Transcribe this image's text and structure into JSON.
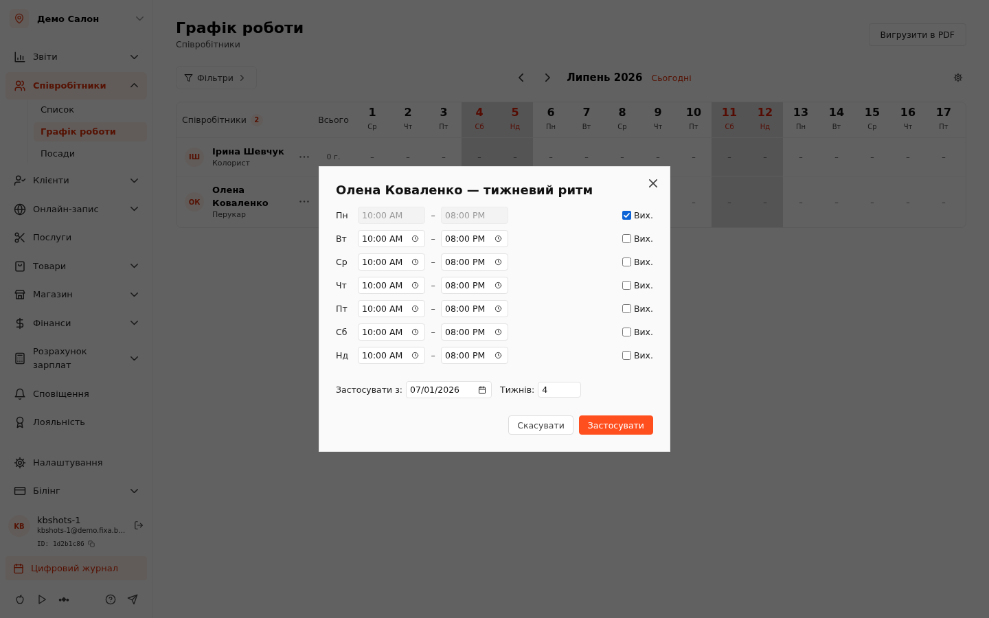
{
  "sidebar": {
    "brand": {
      "name": "Демо Салон"
    },
    "items": [
      {
        "label": "Звіти",
        "expanded": false,
        "selected": false
      },
      {
        "label": "Співробітники",
        "expanded": true,
        "selected": true,
        "children": [
          {
            "label": "Список",
            "selected": false
          },
          {
            "label": "Графік роботи",
            "selected": true
          },
          {
            "label": "Посади",
            "selected": false
          }
        ]
      },
      {
        "label": "Клієнти",
        "expanded": false,
        "selected": false
      },
      {
        "label": "Онлайн-запис",
        "expanded": false,
        "selected": false
      },
      {
        "label": "Послуги",
        "selected": false
      },
      {
        "label": "Товари",
        "expanded": false,
        "selected": false
      },
      {
        "label": "Магазин",
        "expanded": false,
        "selected": false
      },
      {
        "label": "Фінанси",
        "expanded": false,
        "selected": false
      },
      {
        "label": "Розрахунок зарплат",
        "expanded": false,
        "selected": false
      },
      {
        "label": "Сповіщення",
        "selected": false
      },
      {
        "label": "Лояльність",
        "selected": false
      }
    ],
    "footer_items": [
      {
        "label": "Налаштування",
        "selected": false
      },
      {
        "label": "Білінг",
        "expanded": false,
        "selected": false
      }
    ],
    "user": {
      "initials": "KB",
      "name": "kbshots-1",
      "email": "kbshots-1@demo.fixa.b…",
      "id": "ID: 1d2b1c86"
    },
    "journal_button": "Цифровий журнал"
  },
  "page": {
    "title": "Графік роботи",
    "subtitle": "Співробітники",
    "export_button": "Вигрузити в PDF"
  },
  "toolbar": {
    "filters_button": "Фільтри",
    "month": "Липень 2026",
    "today_link": "Сьогодні"
  },
  "table": {
    "employees_heading": "Співробітники",
    "employees_count": "2",
    "total_heading": "Всього",
    "days": [
      {
        "date": "1",
        "weekday": "Ср",
        "weekend": false
      },
      {
        "date": "2",
        "weekday": "Чт",
        "weekend": false
      },
      {
        "date": "3",
        "weekday": "Пт",
        "weekend": false
      },
      {
        "date": "4",
        "weekday": "Сб",
        "weekend": true
      },
      {
        "date": "5",
        "weekday": "Нд",
        "weekend": true
      },
      {
        "date": "6",
        "weekday": "Пн",
        "weekend": false
      },
      {
        "date": "7",
        "weekday": "Вт",
        "weekend": false
      },
      {
        "date": "8",
        "weekday": "Ср",
        "weekend": false
      },
      {
        "date": "9",
        "weekday": "Чт",
        "weekend": false
      },
      {
        "date": "10",
        "weekday": "Пт",
        "weekend": false
      },
      {
        "date": "11",
        "weekday": "Сб",
        "weekend": true
      },
      {
        "date": "12",
        "weekday": "Нд",
        "weekend": true
      },
      {
        "date": "13",
        "weekday": "Пн",
        "weekend": false
      },
      {
        "date": "14",
        "weekday": "Вт",
        "weekend": false
      },
      {
        "date": "15",
        "weekday": "Ср",
        "weekend": false
      },
      {
        "date": "16",
        "weekday": "Чт",
        "weekend": false
      },
      {
        "date": "17",
        "weekday": "Пт",
        "weekend": false
      }
    ],
    "rows": [
      {
        "initials": "ІШ",
        "name": "Ірина Шевчук",
        "role": "Колорист",
        "total": "0 г.",
        "cells": [
          "–",
          "–",
          "–",
          "–",
          "–",
          "–",
          "–",
          "–",
          "–",
          "–",
          "–",
          "–",
          "–",
          "–",
          "–",
          "–",
          "–"
        ]
      },
      {
        "initials": "ОК",
        "name": "Олена Коваленко",
        "role": "Перукар",
        "cells": [
          "",
          "",
          "",
          "",
          "",
          "",
          "",
          "",
          "",
          "–",
          "–",
          "–",
          "–",
          "–",
          "–",
          "–",
          "–"
        ]
      }
    ]
  },
  "modal": {
    "title": "Олена Коваленко — тижневий ритм",
    "days": [
      {
        "day": "Пн",
        "start": "10:00 AM",
        "separator": "–",
        "end": "08:00 PM",
        "day_off": true,
        "off_label": "Вих."
      },
      {
        "day": "Вт",
        "start": "10:00 AM",
        "separator": "–",
        "end": "08:00 PM",
        "day_off": false,
        "off_label": "Вих."
      },
      {
        "day": "Ср",
        "start": "10:00 AM",
        "separator": "–",
        "end": "08:00 PM",
        "day_off": false,
        "off_label": "Вих."
      },
      {
        "day": "Чт",
        "start": "10:00 AM",
        "separator": "–",
        "end": "08:00 PM",
        "day_off": false,
        "off_label": "Вих."
      },
      {
        "day": "Пт",
        "start": "10:00 AM",
        "separator": "–",
        "end": "08:00 PM",
        "day_off": false,
        "off_label": "Вих."
      },
      {
        "day": "Сб",
        "start": "10:00 AM",
        "separator": "–",
        "end": "08:00 PM",
        "day_off": false,
        "off_label": "Вих."
      },
      {
        "day": "Нд",
        "start": "10:00 AM",
        "separator": "–",
        "end": "08:00 PM",
        "day_off": false,
        "off_label": "Вих."
      }
    ],
    "apply_from_label": "Застосувати з:",
    "apply_from": "07/01/2026",
    "weeks_label": "Тижнів:",
    "weeks": "4",
    "cancel_button": "Скасувати",
    "apply_button": "Застосувати"
  }
}
